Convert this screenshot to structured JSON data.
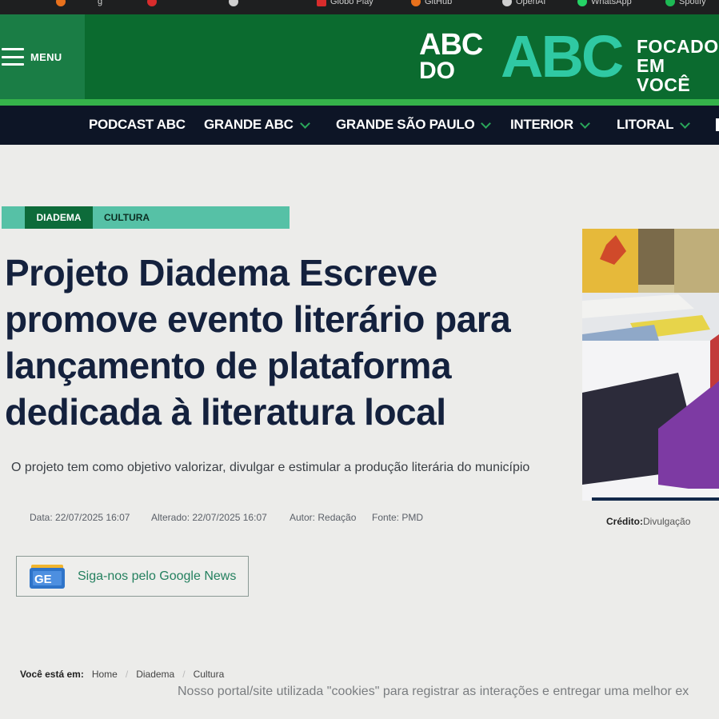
{
  "bookmarks": [
    {
      "label": "",
      "color": "#e8711c"
    },
    {
      "label": "g",
      "color": "#d82c2c"
    },
    {
      "label": "",
      "color": "#ffffff"
    },
    {
      "label": "...",
      "color": "#ffffff"
    },
    {
      "label": "Globo Play",
      "color": "#d82c2c"
    },
    {
      "label": "GitHub",
      "color": "#e8711c"
    },
    {
      "label": "OpenAI",
      "color": "#ffffff"
    },
    {
      "label": "WhatsApp",
      "color": "#25d366"
    },
    {
      "label": "Spotify",
      "color": "#1db954"
    }
  ],
  "header": {
    "menu_label": "MENU",
    "logo_small_top": "ABC",
    "logo_small_bottom": "DO",
    "logo_big": "ABC",
    "tagline_1": "FOCADO",
    "tagline_2": "EM VOCÊ"
  },
  "nav": {
    "items": [
      {
        "label": "PODCAST ABC",
        "dropdown": false
      },
      {
        "label": "GRANDE ABC",
        "dropdown": true
      },
      {
        "label": "GRANDE SÃO PAULO",
        "dropdown": true
      },
      {
        "label": "INTERIOR",
        "dropdown": true
      },
      {
        "label": "LITORAL",
        "dropdown": true
      }
    ]
  },
  "article": {
    "category_city": "DIADEMA",
    "category_section": "CULTURA",
    "headline_lines": [
      "Projeto Diadema Escreve",
      "promove evento literário para",
      "lançamento de plataforma",
      "dedicada à literatura local"
    ],
    "subtitle": "O projeto tem como objetivo valorizar, divulgar e estimular a produção literária do município",
    "meta": {
      "date": "Data: 22/07/2025 16:07",
      "updated": "Alterado: 22/07/2025 16:07",
      "author": "Autor: Redação",
      "source": "Fonte: PMD"
    },
    "credit_label": "Crédito:",
    "credit_value": "Divulgação"
  },
  "gnews": {
    "label": "Siga-nos pelo Google News",
    "icon_text": "GE"
  },
  "breadcrumb": {
    "label": "Você está em:",
    "items": [
      "Home",
      "Diadema",
      "Cultura"
    ]
  },
  "cookies": "Nosso portal/site utilizada \"cookies\" para registrar as interações e entregar uma melhor ex",
  "colors": {
    "brand_green": "#0b6b2f",
    "accent_teal": "#56c1a6",
    "nav_dark": "#0d1526",
    "headline": "#14213d"
  }
}
